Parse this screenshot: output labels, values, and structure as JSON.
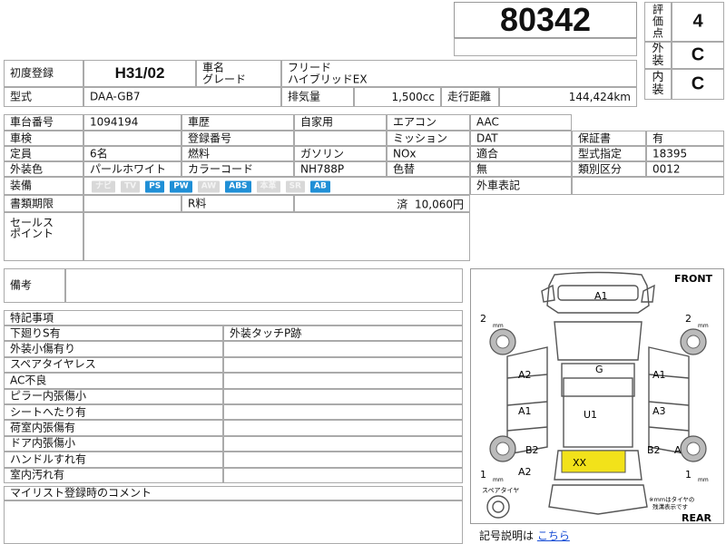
{
  "lot_number": "80342",
  "grades": {
    "score": {
      "label": "評価点",
      "value": "4"
    },
    "exterior": {
      "label": "外装",
      "value": "C"
    },
    "interior": {
      "label": "内装",
      "value": "C"
    }
  },
  "first_reg": {
    "label": "初度登録",
    "value": "H31/02"
  },
  "car_name": {
    "label": "車名\nグレード",
    "value": "フリード\nハイブリッドEX"
  },
  "model": {
    "label": "型式",
    "value": "DAA-GB7"
  },
  "displacement": {
    "label": "排気量",
    "value": "1,500cc"
  },
  "mileage": {
    "label": "走行距離",
    "value": "144,424km"
  },
  "specs": {
    "chassis_no": {
      "label": "車台番号",
      "value": "1094194"
    },
    "history": {
      "label": "車歴",
      "value": "自家用"
    },
    "aircon": {
      "label": "エアコン",
      "value": "AAC"
    },
    "inspection": {
      "label": "車検",
      "value": ""
    },
    "reg_no": {
      "label": "登録番号",
      "value": ""
    },
    "mission": {
      "label": "ミッション",
      "value": "DAT"
    },
    "warranty": {
      "label": "保証書",
      "value": "有"
    },
    "capacity": {
      "label": "定員",
      "value": "6名"
    },
    "fuel": {
      "label": "燃料",
      "value": "ガソリン"
    },
    "nox": {
      "label": "NOx",
      "value": ""
    },
    "nox_fit": {
      "label": "適合",
      "value": ""
    },
    "model_designation": {
      "label": "型式指定",
      "value": "18395"
    },
    "color": {
      "label": "外装色",
      "value": "パールホワイト"
    },
    "color_code": {
      "label": "カラーコード",
      "value": "NH788P"
    },
    "repaint": {
      "label": "色替",
      "value": "無"
    },
    "category": {
      "label": "類別区分",
      "value": "0012"
    }
  },
  "equipment": {
    "label": "装備",
    "items": [
      {
        "name": "ナビ",
        "on": false
      },
      {
        "name": "TV",
        "on": false
      },
      {
        "name": "PS",
        "on": true
      },
      {
        "name": "PW",
        "on": true
      },
      {
        "name": "AW",
        "on": false
      },
      {
        "name": "ABS",
        "on": true
      },
      {
        "name": "本革",
        "on": false
      },
      {
        "name": "SR",
        "on": false
      },
      {
        "name": "AB",
        "on": true
      }
    ],
    "import_label": "外車表記"
  },
  "docs": {
    "label": "書類期限",
    "value": "",
    "r_label": "R料",
    "r_value": "済  10,060円"
  },
  "sales_point": {
    "label": "セールス\nポイント",
    "value": ""
  },
  "remarks": {
    "label": "備考",
    "value": ""
  },
  "notes": {
    "title": "特記事項",
    "left": [
      "下廻りS有",
      "外装小傷有り",
      "スペアタイヤレス",
      "AC不良",
      "ピラー内張傷小",
      "シートへたり有",
      "荷室内張傷有",
      "ドア内張傷小",
      "ハンドルすれ有",
      "室内汚れ有"
    ],
    "right": [
      "外装タッチP跡",
      "",
      "",
      "",
      "",
      "",
      "",
      "",
      "",
      ""
    ]
  },
  "mylist": {
    "label": "マイリスト登録時のコメント"
  },
  "diagram": {
    "front": "FRONT",
    "rear": "REAR",
    "marks": {
      "a1_top": "A1",
      "g": "G",
      "u1": "U1",
      "xx": "XX",
      "a2_left_upper": "A2",
      "a1_left": "A1",
      "b2_left": "B2",
      "a2_left_lower": "A2",
      "a1_right": "A1",
      "a3_right": "A3",
      "b2_right": "B2",
      "a_right": "A"
    },
    "tire_nums": {
      "fl": "2",
      "fr": "2",
      "rl": "1",
      "rr": "1"
    },
    "mm": "mm",
    "spare": "スペアタイヤ",
    "note": "※mmはタイヤの\n残溝表示です",
    "highlight_color": "#f2e21a"
  },
  "legend": {
    "label": "記号説明は",
    "link": "こちら"
  }
}
